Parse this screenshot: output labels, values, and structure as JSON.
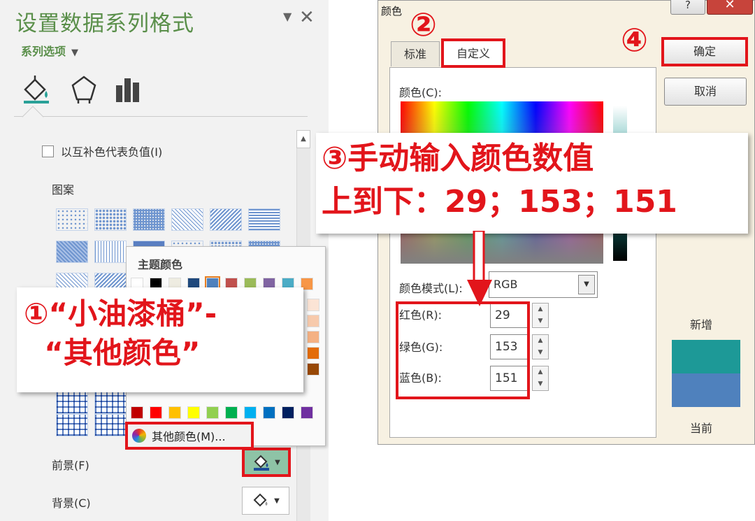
{
  "left_pane": {
    "title": "设置数据系列格式",
    "series_options": "系列选项",
    "invert_label": "以互补色代表负值(I)",
    "pattern_label": "图案",
    "foreground_label": "前景(F)",
    "background_label": "背景(C)",
    "tab_icons": [
      "fill-line-icon",
      "effects-icon",
      "series-options-icon"
    ],
    "colors": {
      "title_green": "#5a8f4a",
      "highlight_red": "#e2151b",
      "foreground_btn_bg": "#8ec3a6"
    }
  },
  "color_popup": {
    "theme_label": "主题颜色",
    "more_colors_label": "其他颜色(M)...",
    "theme_row": [
      "#ffffff",
      "#000000",
      "#eeece1",
      "#1f497d",
      "#4f81bd",
      "#c0504d",
      "#9bbb59",
      "#8064a2",
      "#4bacc6",
      "#f79646"
    ],
    "standard_row": [
      "#c00000",
      "#ff0000",
      "#ffc000",
      "#ffff00",
      "#92d050",
      "#00b050",
      "#00b0f0",
      "#0070c0",
      "#002060",
      "#7030a0"
    ]
  },
  "callout1": {
    "text": "①“小油漆桶”-\n  “其他颜色”"
  },
  "dialog": {
    "title": "颜色",
    "help_label": "?",
    "close_label": "✕",
    "tab_standard": "标准",
    "tab_custom": "自定义",
    "colors_label": "颜色(C):",
    "model_label": "颜色模式(L):",
    "model_value": "RGB",
    "red_label": "红色(R):",
    "green_label": "绿色(G):",
    "blue_label": "蓝色(B):",
    "red_value": "29",
    "green_value": "153",
    "blue_value": "151",
    "ok_label": "确定",
    "cancel_label": "取消",
    "new_label": "新增",
    "current_label": "当前",
    "new_color": "#1d9997",
    "current_color": "#4f81bd"
  },
  "steps": {
    "two": "②",
    "four": "④"
  },
  "callout3": {
    "text": "③手动输入颜色数值\n上到下：29；153；151"
  }
}
